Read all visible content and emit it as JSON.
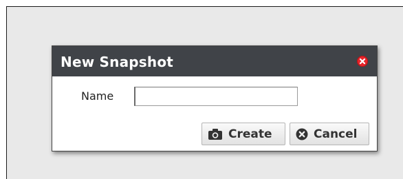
{
  "dialog": {
    "title": "New Snapshot",
    "close_icon": "close-circle-icon",
    "name_label": "Name",
    "name_value": "",
    "name_placeholder": "",
    "buttons": {
      "create": {
        "label": "Create",
        "icon": "camera-icon"
      },
      "cancel": {
        "label": "Cancel",
        "icon": "cancel-circle-icon"
      }
    }
  },
  "colors": {
    "titlebar": "#404348",
    "close_button": "#e8252b",
    "background": "#e9e9e9"
  }
}
